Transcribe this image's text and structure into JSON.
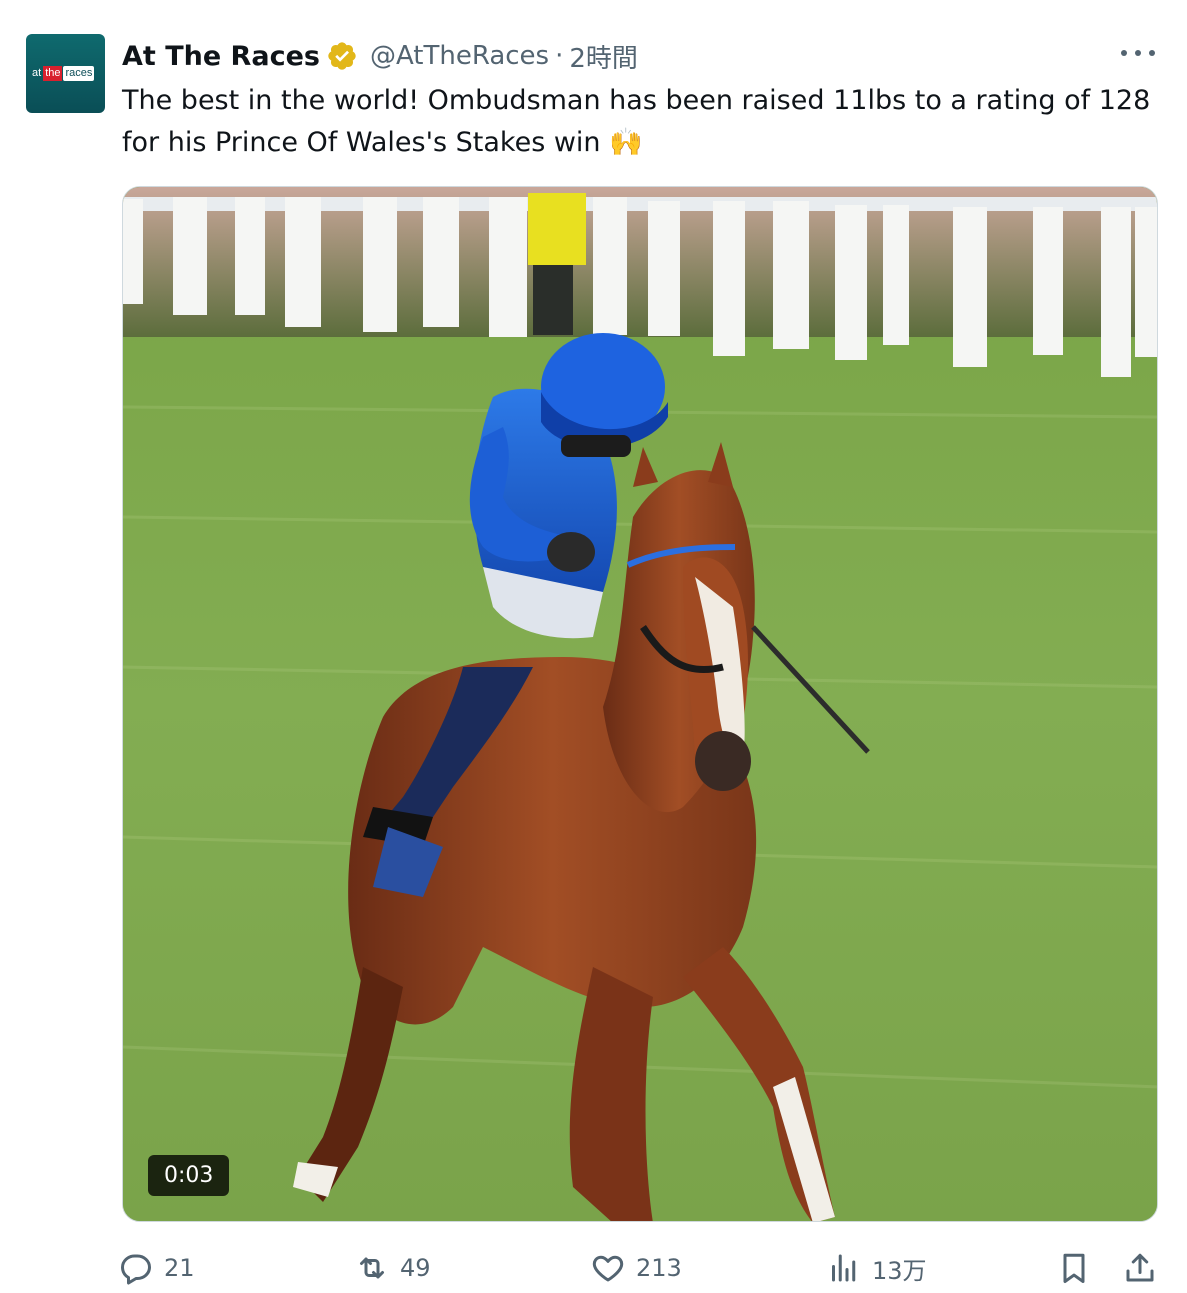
{
  "author": {
    "name": "At The Races",
    "handle": "@AtTheRaces",
    "separator": "·",
    "time": "2時間",
    "verified_icon": "verified-badge-icon",
    "avatar_logo": {
      "part1": "at",
      "part2": "the",
      "part3": "races"
    }
  },
  "tweet": {
    "text": "The best in the world! Ombudsman has been raised 11lbs to a rating of 128 for his Prince Of Wales's Stakes win 🙌"
  },
  "media": {
    "type": "video",
    "duration": "0:03"
  },
  "actions": {
    "reply": {
      "icon": "reply-icon",
      "count": "21"
    },
    "retweet": {
      "icon": "retweet-icon",
      "count": "49"
    },
    "like": {
      "icon": "heart-icon",
      "count": "213"
    },
    "views": {
      "icon": "views-icon",
      "count": "13万"
    },
    "bookmark": {
      "icon": "bookmark-icon"
    },
    "share": {
      "icon": "share-icon"
    }
  },
  "colors": {
    "text_primary": "#0f1419",
    "text_secondary": "#536471",
    "verified_gold": "#e2b719",
    "jockey_blue": "#1f5fd1",
    "turf_green": "#7ba14a"
  }
}
